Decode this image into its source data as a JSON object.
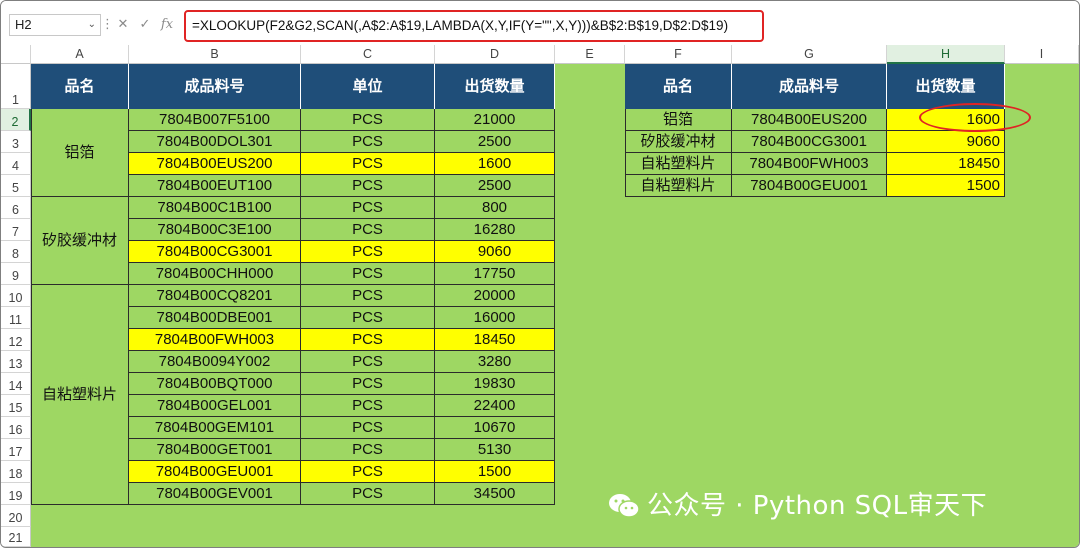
{
  "formula_bar": {
    "name_box": "H2",
    "name_box_dropdown": "⌄",
    "more_icon": "⋮",
    "cancel_icon": "✕",
    "enter_icon": "✓",
    "fx_icon": "fx",
    "formula": "=XLOOKUP(F2&G2,SCAN(,A$2:A$19,LAMBDA(X,Y,IF(Y=\"\",X,Y)))&B$2:B$19,D$2:D$19)"
  },
  "columns": [
    "A",
    "B",
    "C",
    "D",
    "E",
    "F",
    "G",
    "H",
    "I"
  ],
  "selected_column": "H",
  "rows": [
    "1",
    "2",
    "3",
    "4",
    "5",
    "6",
    "7",
    "8",
    "9",
    "10",
    "11",
    "12",
    "13",
    "14",
    "15",
    "16",
    "17",
    "18",
    "19",
    "20",
    "21"
  ],
  "selected_row": "2",
  "colors": {
    "sheet_bg": "#9ed763",
    "header_bg": "#1f4e79",
    "highlight": "#ffff00",
    "annotation": "#e02424"
  },
  "left_table": {
    "headers": [
      "品名",
      "成品料号",
      "单位",
      "出货数量"
    ],
    "groups": [
      {
        "name": "铝箔",
        "rows": [
          {
            "code": "7804B007F5100",
            "unit": "PCS",
            "qty": "21000",
            "highlight": false
          },
          {
            "code": "7804B00DOL301",
            "unit": "PCS",
            "qty": "2500",
            "highlight": false
          },
          {
            "code": "7804B00EUS200",
            "unit": "PCS",
            "qty": "1600",
            "highlight": true
          },
          {
            "code": "7804B00EUT100",
            "unit": "PCS",
            "qty": "2500",
            "highlight": false
          }
        ]
      },
      {
        "name": "矽胶缓冲材",
        "rows": [
          {
            "code": "7804B00C1B100",
            "unit": "PCS",
            "qty": "800",
            "highlight": false
          },
          {
            "code": "7804B00C3E100",
            "unit": "PCS",
            "qty": "16280",
            "highlight": false
          },
          {
            "code": "7804B00CG3001",
            "unit": "PCS",
            "qty": "9060",
            "highlight": true
          },
          {
            "code": "7804B00CHH000",
            "unit": "PCS",
            "qty": "17750",
            "highlight": false
          }
        ]
      },
      {
        "name": "自粘塑料片",
        "rows": [
          {
            "code": "7804B00CQ8201",
            "unit": "PCS",
            "qty": "20000",
            "highlight": false
          },
          {
            "code": "7804B00DBE001",
            "unit": "PCS",
            "qty": "16000",
            "highlight": false
          },
          {
            "code": "7804B00FWH003",
            "unit": "PCS",
            "qty": "18450",
            "highlight": true
          },
          {
            "code": "7804B0094Y002",
            "unit": "PCS",
            "qty": "3280",
            "highlight": false
          },
          {
            "code": "7804B00BQT000",
            "unit": "PCS",
            "qty": "19830",
            "highlight": false
          },
          {
            "code": "7804B00GEL001",
            "unit": "PCS",
            "qty": "22400",
            "highlight": false
          },
          {
            "code": "7804B00GEM101",
            "unit": "PCS",
            "qty": "10670",
            "highlight": false
          },
          {
            "code": "7804B00GET001",
            "unit": "PCS",
            "qty": "5130",
            "highlight": false
          },
          {
            "code": "7804B00GEU001",
            "unit": "PCS",
            "qty": "1500",
            "highlight": true
          },
          {
            "code": "7804B00GEV001",
            "unit": "PCS",
            "qty": "34500",
            "highlight": false
          }
        ]
      }
    ]
  },
  "right_table": {
    "headers": [
      "品名",
      "成品料号",
      "出货数量"
    ],
    "rows": [
      {
        "name": "铝箔",
        "code": "7804B00EUS200",
        "qty": "1600"
      },
      {
        "name": "矽胶缓冲材",
        "code": "7804B00CG3001",
        "qty": "9060"
      },
      {
        "name": "自粘塑料片",
        "code": "7804B00FWH003",
        "qty": "18450"
      },
      {
        "name": "自粘塑料片",
        "code": "7804B00GEU001",
        "qty": "1500"
      }
    ]
  },
  "watermark": {
    "text": "公众号 · Python SQL审天下",
    "icon": "wechat-icon"
  }
}
